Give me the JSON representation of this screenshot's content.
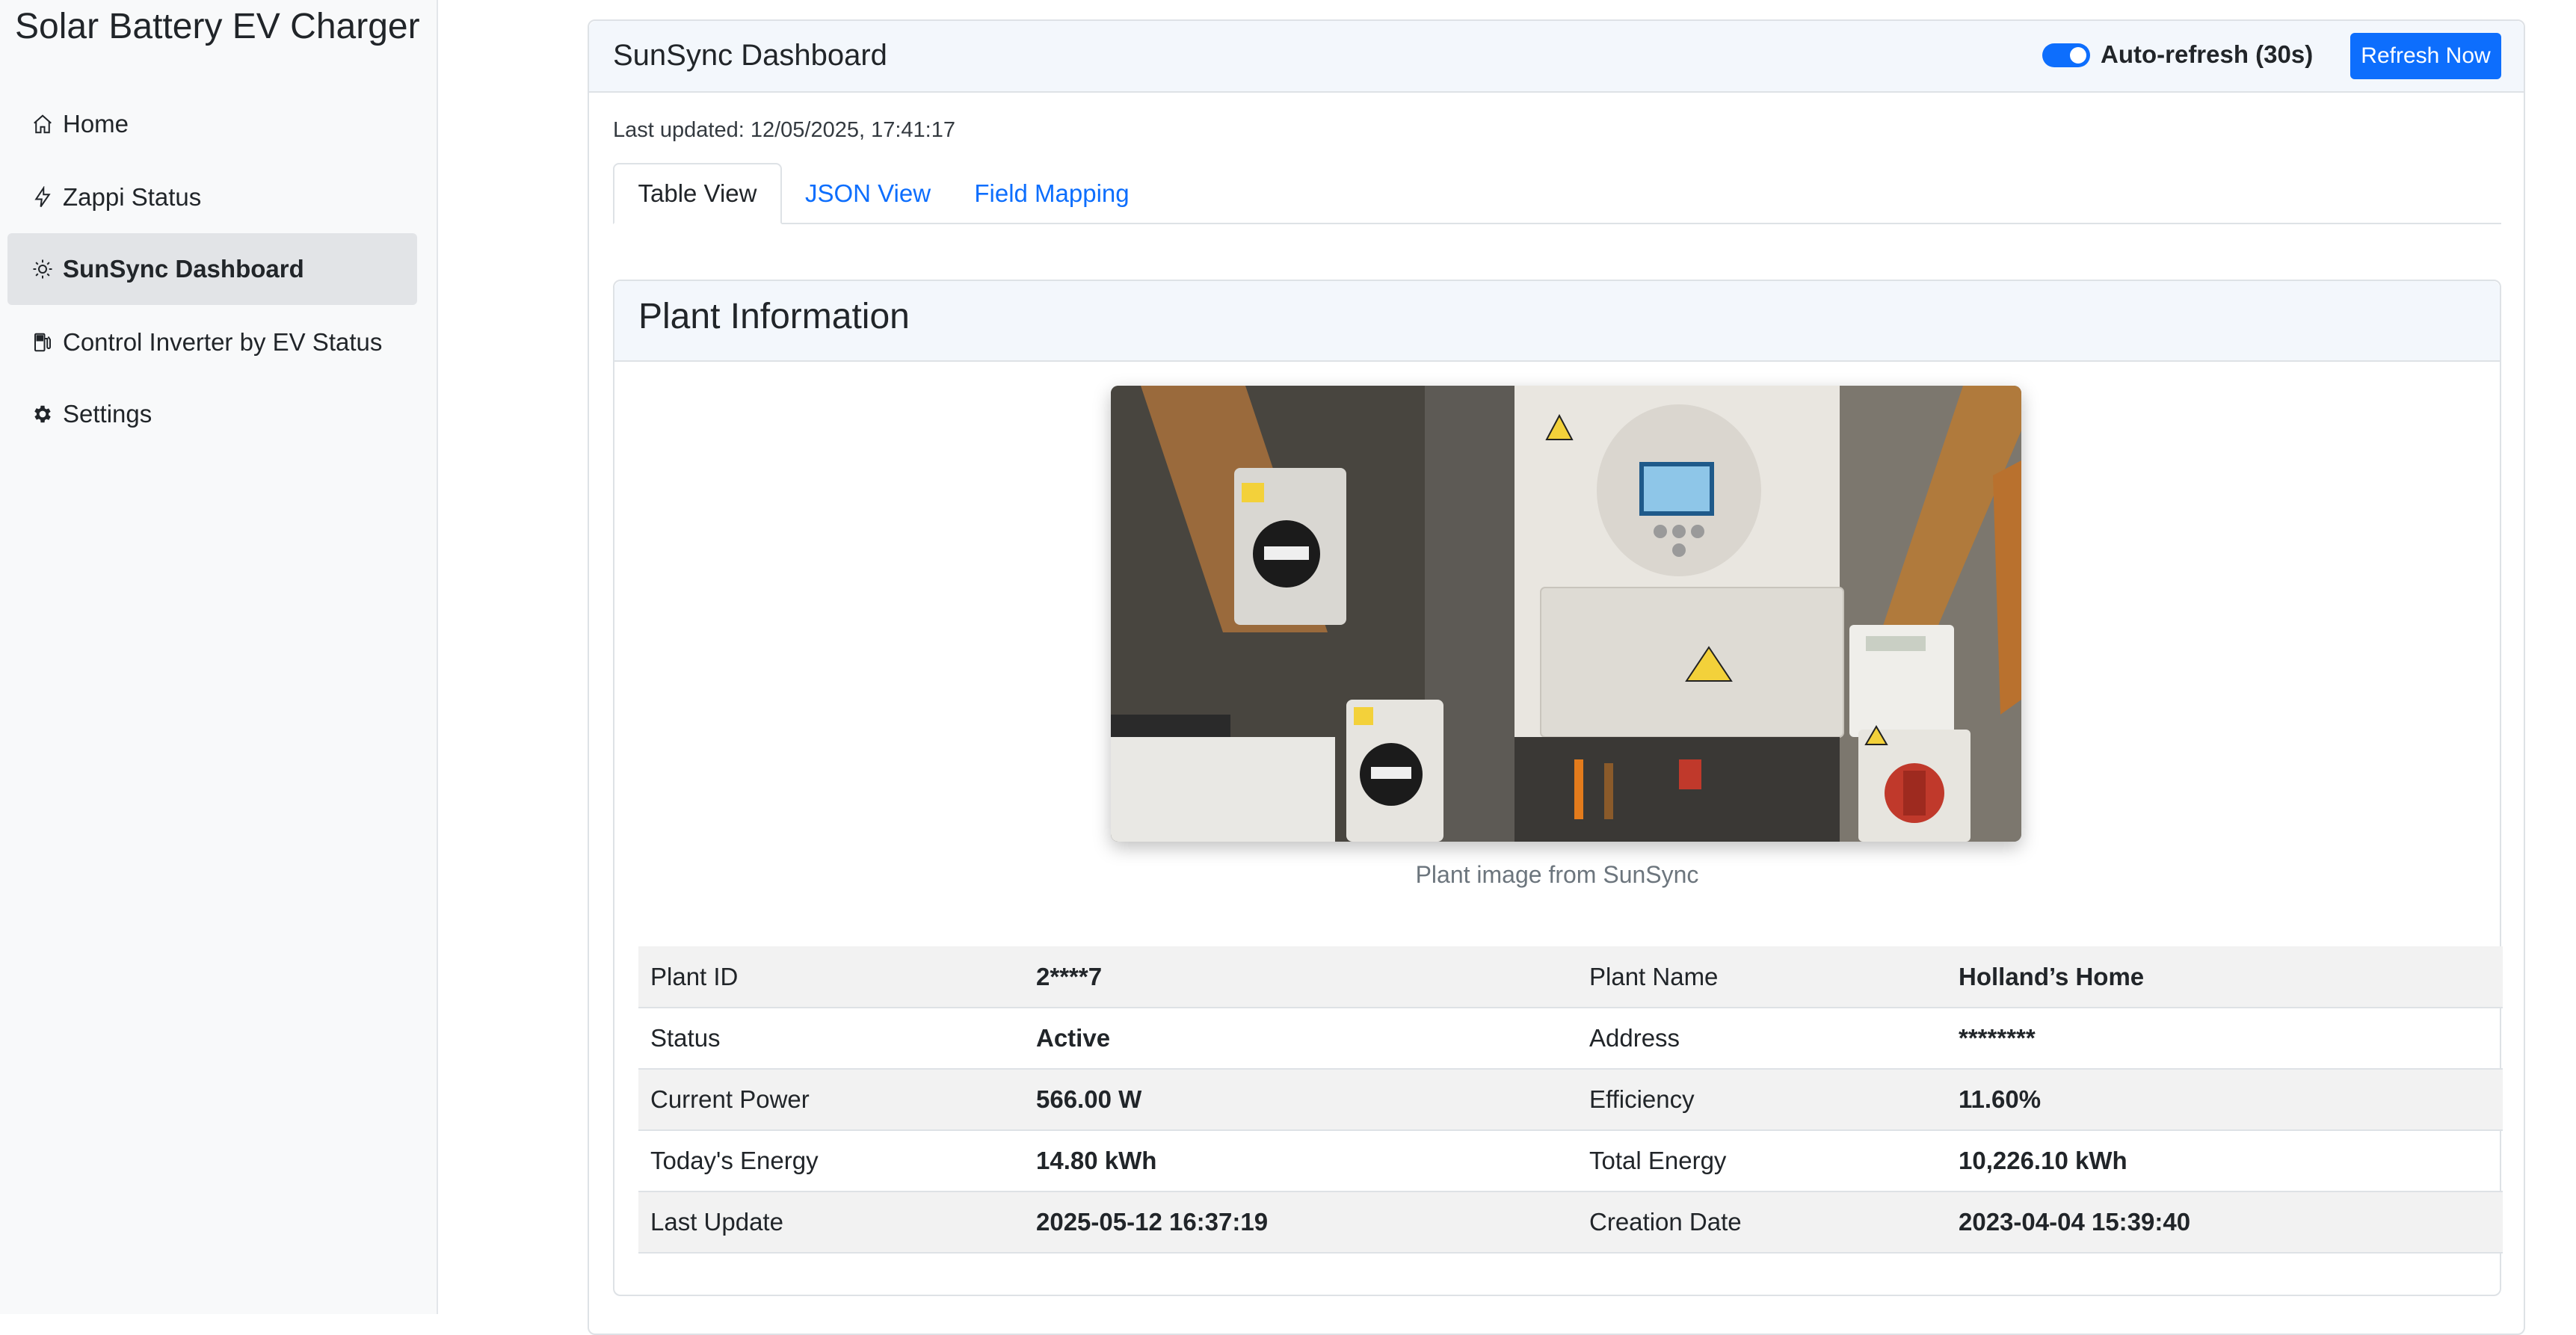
{
  "app": {
    "title": "Solar Battery EV Charger"
  },
  "sidebar": {
    "items": [
      {
        "label": "Home",
        "icon": "home-icon"
      },
      {
        "label": "Zappi Status",
        "icon": "lightning-icon"
      },
      {
        "label": "SunSync Dashboard",
        "icon": "sun-icon",
        "active": true
      },
      {
        "label": "Control Inverter by EV Status",
        "icon": "fuel-pump-icon"
      },
      {
        "label": "Settings",
        "icon": "gear-icon"
      }
    ]
  },
  "dashboard": {
    "title": "SunSync Dashboard",
    "auto_refresh_label": "Auto-refresh (30s)",
    "auto_refresh_enabled": true,
    "refresh_button": "Refresh Now",
    "last_updated": "Last updated: 12/05/2025, 17:41:17",
    "tabs": [
      {
        "label": "Table View",
        "active": true
      },
      {
        "label": "JSON View"
      },
      {
        "label": "Field Mapping"
      }
    ]
  },
  "plant": {
    "title": "Plant Information",
    "image_caption": "Plant image from SunSync",
    "rows": [
      {
        "label1": "Plant ID",
        "value1": "2****7",
        "label2": "Plant Name",
        "value2": "Holland’s Home"
      },
      {
        "label1": "Status",
        "value1": "Active",
        "label2": "Address",
        "value2": "********"
      },
      {
        "label1": "Current Power",
        "value1": "566.00 W",
        "label2": "Efficiency",
        "value2": "11.60%"
      },
      {
        "label1": "Today's Energy",
        "value1": "14.80 kWh",
        "label2": "Total Energy",
        "value2": "10,226.10 kWh"
      },
      {
        "label1": "Last Update",
        "value1": "2025-05-12 16:37:19",
        "label2": "Creation Date",
        "value2": "2023-04-04 15:39:40"
      }
    ]
  },
  "colors": {
    "accent": "#0d6efd",
    "header_bg": "#f3f7fc",
    "sidebar_bg": "#f8f9fa",
    "active_nav_bg": "#e2e4e7"
  }
}
